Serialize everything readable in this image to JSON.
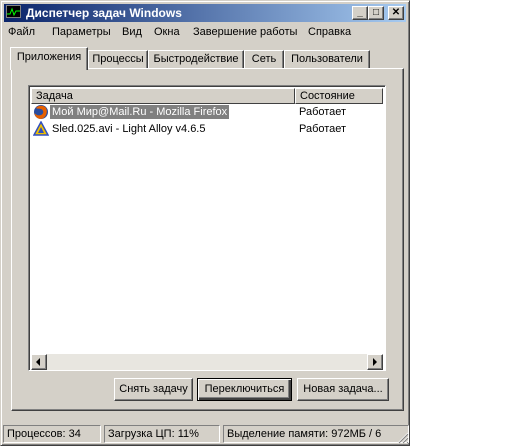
{
  "window": {
    "title": "Диспетчер задач Windows",
    "controls": {
      "minimize": "_",
      "maximize": "□",
      "close": "✕"
    }
  },
  "menu": [
    "Файл",
    "Параметры",
    "Вид",
    "Окна",
    "Завершение работы",
    "Справка"
  ],
  "tabs": [
    "Приложения",
    "Процессы",
    "Быстродействие",
    "Сеть",
    "Пользователи"
  ],
  "active_tab": "Приложения",
  "list": {
    "columns": [
      "Задача",
      "Состояние"
    ],
    "rows": [
      {
        "name": "Мой Мир@Mail.Ru - Mozilla Firefox",
        "state": "Работает",
        "icon": "firefox-icon",
        "selected": true
      },
      {
        "name": "Sled.025.avi - Light Alloy v4.6.5",
        "state": "Работает",
        "icon": "light-alloy-icon",
        "selected": false
      }
    ]
  },
  "buttons": {
    "end_task": "Снять задачу",
    "switch_to": "Переключиться",
    "new_task": "Новая задача..."
  },
  "status": {
    "processes": "Процессов: 34",
    "cpu": "Загрузка ЦП: 11%",
    "memory": "Выделение памяти: 972МБ / 6"
  },
  "colors": {
    "titlebar_start": "#0a246a",
    "titlebar_end": "#a6caf0",
    "face": "#d4d0c8",
    "selection": "#808080"
  }
}
